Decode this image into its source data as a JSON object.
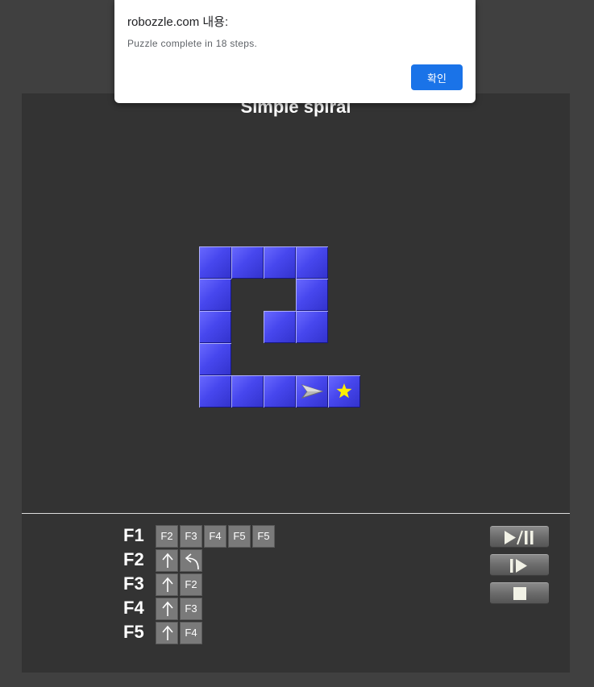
{
  "dialog": {
    "origin": "robozzle.com 내용:",
    "message": "Puzzle complete in 18 steps.",
    "ok_label": "확인"
  },
  "puzzle": {
    "title": "Simple spiral",
    "tile_color": "#4646ee",
    "board_grid": [
      "BBBB.",
      "B..B.",
      "B.BB.",
      "B....",
      "BBB>*"
    ],
    "robot": {
      "row": 4,
      "col": 3,
      "facing": "right"
    },
    "star": {
      "row": 4,
      "col": 4,
      "color": "#ffee00"
    }
  },
  "program": {
    "functions": [
      {
        "label": "F1",
        "commands": [
          {
            "kind": "call",
            "text": "F2"
          },
          {
            "kind": "call",
            "text": "F3"
          },
          {
            "kind": "call",
            "text": "F4"
          },
          {
            "kind": "call",
            "text": "F5"
          },
          {
            "kind": "call",
            "text": "F5"
          }
        ]
      },
      {
        "label": "F2",
        "commands": [
          {
            "kind": "icon",
            "icon": "forward-arrow-icon"
          },
          {
            "kind": "icon",
            "icon": "turn-left-icon"
          }
        ]
      },
      {
        "label": "F3",
        "commands": [
          {
            "kind": "icon",
            "icon": "forward-arrow-icon"
          },
          {
            "kind": "call",
            "text": "F2"
          }
        ]
      },
      {
        "label": "F4",
        "commands": [
          {
            "kind": "icon",
            "icon": "forward-arrow-icon"
          },
          {
            "kind": "call",
            "text": "F3"
          }
        ]
      },
      {
        "label": "F5",
        "commands": [
          {
            "kind": "icon",
            "icon": "forward-arrow-icon"
          },
          {
            "kind": "call",
            "text": "F4"
          }
        ]
      }
    ]
  },
  "controls": [
    {
      "name": "play-pause-button",
      "icon": "play-pause-icon"
    },
    {
      "name": "step-button",
      "icon": "step-icon"
    },
    {
      "name": "stop-button",
      "icon": "stop-icon"
    }
  ]
}
